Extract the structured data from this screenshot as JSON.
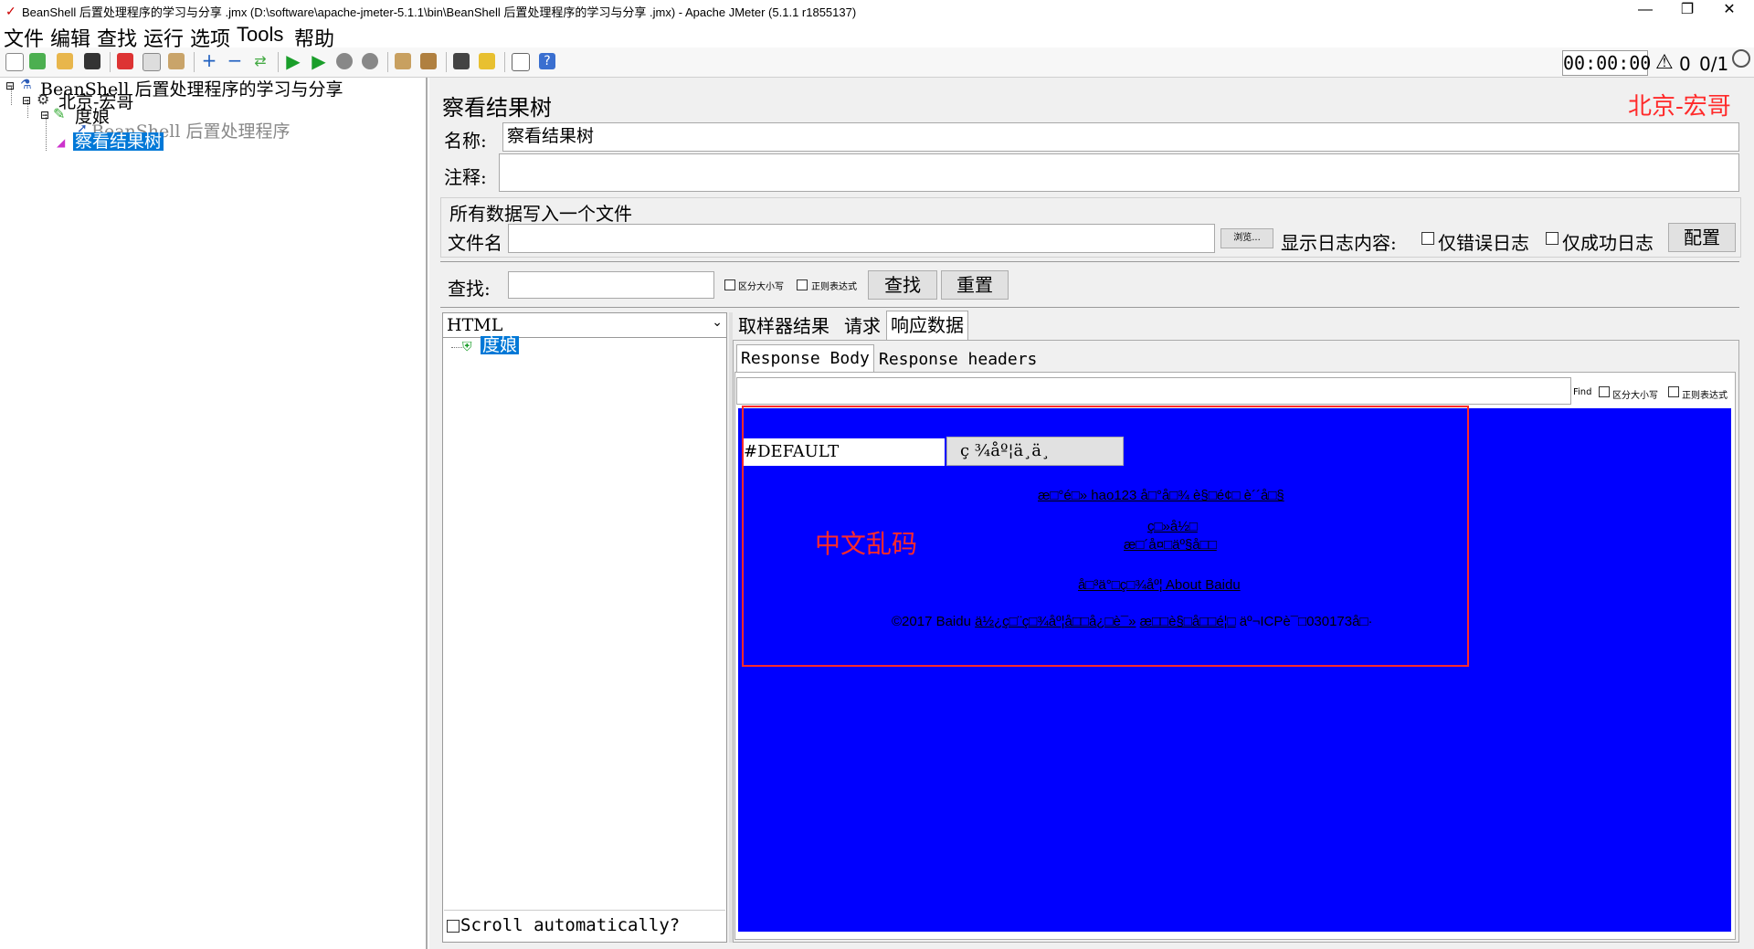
{
  "window": {
    "title": "BeanShell 后置处理程序的学习与分享 .jmx (D:\\software\\apache-jmeter-5.1.1\\bin\\BeanShell 后置处理程序的学习与分享 .jmx) - Apache JMeter (5.1.1 r1855137)",
    "minimize": "—",
    "restore": "❐",
    "close": "✕"
  },
  "menu": [
    "文件",
    "编辑",
    "查找",
    "运行",
    "选项",
    "Tools",
    "帮助"
  ],
  "toolbar": {
    "timer": "00:00:00",
    "warning_count": "0",
    "threads": "0/1"
  },
  "tree": {
    "root": "BeanShell 后置处理程序的学习与分享",
    "thread_group": "北京-宏哥",
    "sampler": "度娘",
    "postprocessor": "BeanShell 后置处理程序",
    "listener": "察看结果树"
  },
  "listener_panel": {
    "title": "察看结果树",
    "watermark": "北京-宏哥",
    "name_label": "名称:",
    "name_value": "察看结果树",
    "comment_label": "注释:",
    "file_section": "所有数据写入一个文件",
    "filename_label": "文件名",
    "browse": "浏览...",
    "log_label": "显示日志内容:",
    "errors_only": "仅错误日志",
    "success_only": "仅成功日志",
    "configure": "配置",
    "search_label": "查找:",
    "case_sensitive": "区分大小写",
    "regex": "正则表达式",
    "find_button": "查找",
    "reset_button": "重置",
    "renderer": "HTML",
    "result_item": "度娘",
    "scroll_auto": "Scroll automatically?",
    "tabs": [
      "取样器结果",
      "请求",
      "响应数据"
    ],
    "subtabs": [
      "Response Body",
      "Response headers"
    ],
    "find_small": "Find",
    "case_small": "区分大小写",
    "regex_small": "正则表达式"
  },
  "response_html": {
    "input_value": "#DEFAULT",
    "button_text": "ç  ¾åº¦ä¸ä¸",
    "link1": "æ□°é□» hao123 å□°å□¾ è§□é¢□ è´´å□§",
    "link2": "ç□»å½□",
    "link3": "æ□´å¤□äº§å□□",
    "link4": "å□³ä°□ç□¾åº¦ About Baidu",
    "footer_prefix": "©2017 Baidu ",
    "footer_link1": "ä½¿ç□¨ç□¾åº¦å□□å¿□è¯»",
    "footer_link2": "æ□□è§□å□□é¦□",
    "footer_suffix": " äº¬ICPè¯□030173å□·",
    "annotation": "中文乱码"
  },
  "colors": {
    "response_bg": "#0000ff",
    "annotation": "#ff2a2a",
    "selection": "#0078d7"
  }
}
